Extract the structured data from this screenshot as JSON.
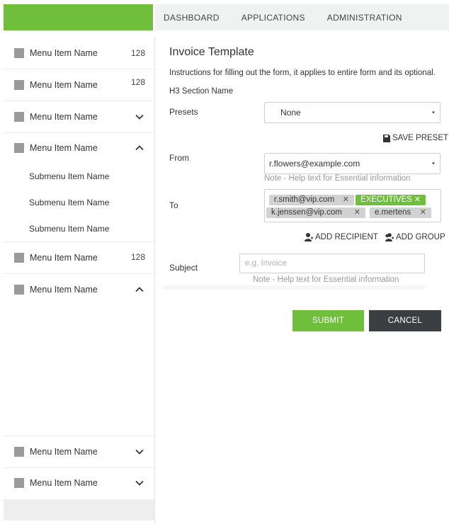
{
  "topnav": {
    "items": [
      {
        "label": "DASHBOARD"
      },
      {
        "label": "APPLICATIONS"
      },
      {
        "label": "ADMINISTRATION"
      }
    ]
  },
  "sidebar": {
    "items": [
      {
        "label": "Menu Item Name",
        "count": "128"
      },
      {
        "label": "Menu Item Name",
        "count": "128"
      },
      {
        "label": "Menu Item Name",
        "state": "collapsed"
      },
      {
        "label": "Menu Item Name",
        "state": "expanded",
        "subitems": [
          {
            "label": "Submenu Item Name"
          },
          {
            "label": "Submenu Item Name"
          },
          {
            "label": "Submenu Item Name"
          }
        ]
      },
      {
        "label": "Menu Item Name",
        "count": "128"
      },
      {
        "label": "Menu Item Name",
        "state": "expanded"
      },
      {
        "label": "Menu Item Name",
        "state": "collapsed"
      },
      {
        "label": "Menu Item Name",
        "state": "collapsed"
      }
    ]
  },
  "form": {
    "title": "Invoice Template",
    "instructions": "Instructions for filling out the form, it applies to entire form and its optional.",
    "section_name": "H3 Section Name",
    "presets": {
      "label": "Presets",
      "value": "None"
    },
    "save_preset": "SAVE PRESET",
    "from": {
      "label": "From",
      "value": "r.flowers@example.com",
      "help": "Note - Help text for Essential information"
    },
    "to": {
      "label": "To",
      "tags": [
        {
          "text": "r.smith@vip.com",
          "style": "gray"
        },
        {
          "text": "EXECUTIVES",
          "style": "green"
        },
        {
          "text": "k.jenssen@vip.com",
          "style": "gray"
        },
        {
          "text": "e.mertens",
          "style": "gray"
        }
      ]
    },
    "add_recipient": "ADD RECIPIENT",
    "add_group": "ADD GROUP",
    "subject": {
      "label": "Subject",
      "placeholder": "e.g. Invoice",
      "help": "Note - Help text for Essential information"
    },
    "submit_label": "SUBMIT",
    "cancel_label": "CANCEL"
  },
  "colors": {
    "accent": "#6fbf3c",
    "dark_button": "#3c3f41"
  }
}
